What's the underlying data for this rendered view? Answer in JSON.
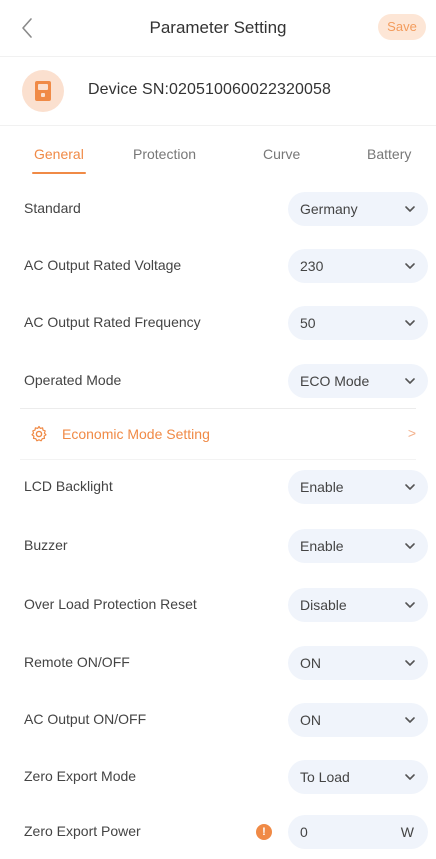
{
  "header": {
    "title": "Parameter Setting",
    "save_label": "Save"
  },
  "device": {
    "sn_text": "Device SN:020510060022320058"
  },
  "tabs": [
    {
      "label": "General",
      "active": true
    },
    {
      "label": "Protection",
      "active": false
    },
    {
      "label": "Curve",
      "active": false
    },
    {
      "label": "Battery",
      "active": false
    }
  ],
  "settings": {
    "standard": {
      "label": "Standard",
      "value": "Germany"
    },
    "ac_voltage": {
      "label": "AC Output Rated Voltage",
      "value": "230"
    },
    "ac_frequency": {
      "label": "AC Output Rated Frequency",
      "value": "50"
    },
    "operated_mode": {
      "label": "Operated Mode",
      "value": "ECO Mode"
    },
    "lcd_backlight": {
      "label": "LCD Backlight",
      "value": "Enable"
    },
    "buzzer": {
      "label": "Buzzer",
      "value": "Enable"
    },
    "overload_reset": {
      "label": "Over Load Protection Reset",
      "value": "Disable"
    },
    "remote_onoff": {
      "label": "Remote ON/OFF",
      "value": "ON"
    },
    "ac_onoff": {
      "label": "AC Output ON/OFF",
      "value": "ON"
    },
    "zero_export_mode": {
      "label": "Zero Export Mode",
      "value": "To Load"
    },
    "zero_export_power": {
      "label": "Zero Export Power",
      "value": "0",
      "unit": "W"
    }
  },
  "economic": {
    "label": "Economic Mode Setting",
    "arrow": ">"
  },
  "icons": {
    "back": "chevron-left-icon",
    "device": "inverter-device-icon",
    "economic": "gear-icon",
    "dropdown": "chevron-down-icon",
    "info": "info-icon"
  },
  "colors": {
    "accent": "#f08a46",
    "pill_bg": "#f0f4fb",
    "save_bg": "#fde6d6"
  }
}
